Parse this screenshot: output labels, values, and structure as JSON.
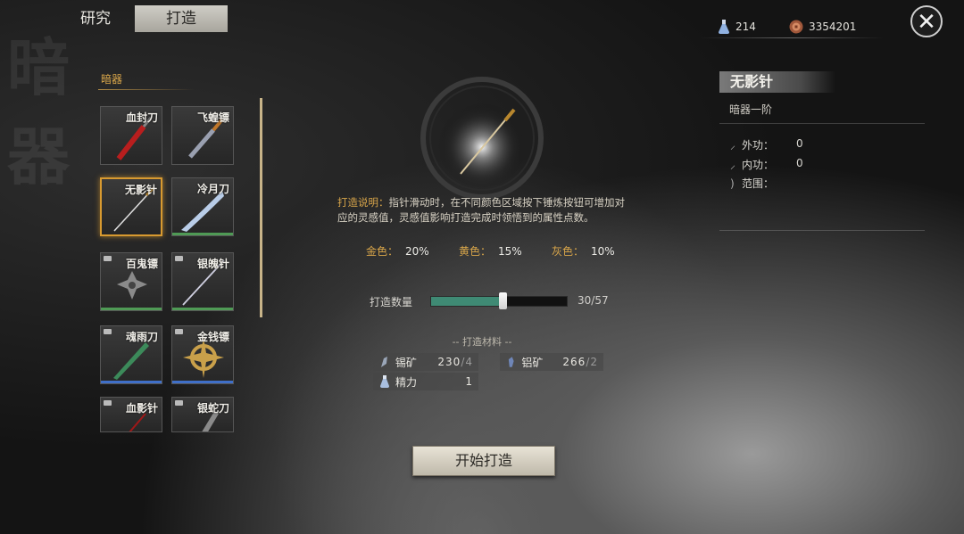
{
  "tabs": {
    "research": "研究",
    "forge": "打造"
  },
  "background_calligraphy": [
    "暗",
    "器"
  ],
  "resources": {
    "stamina": {
      "icon": "potion-flask-icon",
      "value": "214"
    },
    "coins": {
      "icon": "copper-coin-icon",
      "value": "3354201"
    }
  },
  "close_icon": "close-icon",
  "category": {
    "label": "暗器"
  },
  "weapons": [
    {
      "name": "血封刀",
      "locked": false,
      "bar_color": ""
    },
    {
      "name": "飞蝗镖",
      "locked": false,
      "bar_color": ""
    },
    {
      "name": "无影针",
      "locked": false,
      "bar_color": "",
      "selected": true
    },
    {
      "name": "冷月刀",
      "locked": false,
      "bar_color": "#4f9a55"
    },
    {
      "name": "百鬼镖",
      "locked": true,
      "bar_color": "#4f9a55"
    },
    {
      "name": "银魄针",
      "locked": true,
      "bar_color": "#4f9a55"
    },
    {
      "name": "魂雨刀",
      "locked": true,
      "bar_color": "#3f6fc8"
    },
    {
      "name": "金钱镖",
      "locked": true,
      "bar_color": "#3f6fc8"
    },
    {
      "name": "血影针",
      "locked": true,
      "bar_color": ""
    },
    {
      "name": "银蛇刀",
      "locked": true,
      "bar_color": ""
    }
  ],
  "description": {
    "label": "打造说明：",
    "text": "指针滑动时，在不同颜色区域按下锤炼按钮可增加对应的灵感值，灵感值影响打造完成时领悟到的属性点数。"
  },
  "ratios": [
    {
      "key": "金色：",
      "value": "20%"
    },
    {
      "key": "黄色：",
      "value": "15%"
    },
    {
      "key": "灰色：",
      "value": "10%"
    }
  ],
  "quantity": {
    "label": "打造数量",
    "current": 30,
    "max": 57,
    "text": "30/57"
  },
  "materials": {
    "title": "打造材料",
    "items": [
      {
        "name": "锡矿",
        "have": "230",
        "need": "/4",
        "icon": "tin-ore-icon"
      },
      {
        "name": "铝矿",
        "have": "266",
        "need": "/2",
        "icon": "aluminum-ore-icon"
      },
      {
        "name": "精力",
        "have": "1",
        "need": "",
        "icon": "energy-flask-icon"
      }
    ]
  },
  "start_button": "开始打造",
  "item": {
    "name": "无影针",
    "tier": "暗器一阶",
    "stats": [
      {
        "label": "外功：",
        "value": "0",
        "icon": "external-power-icon"
      },
      {
        "label": "内功：",
        "value": "0",
        "icon": "internal-power-icon"
      },
      {
        "label": "范围：",
        "value": "",
        "icon": "range-icon"
      }
    ]
  },
  "colors": {
    "accent_gold": "#d9a64a",
    "selected_border": "#d89a30",
    "slider_fill": "#3f8a74"
  }
}
